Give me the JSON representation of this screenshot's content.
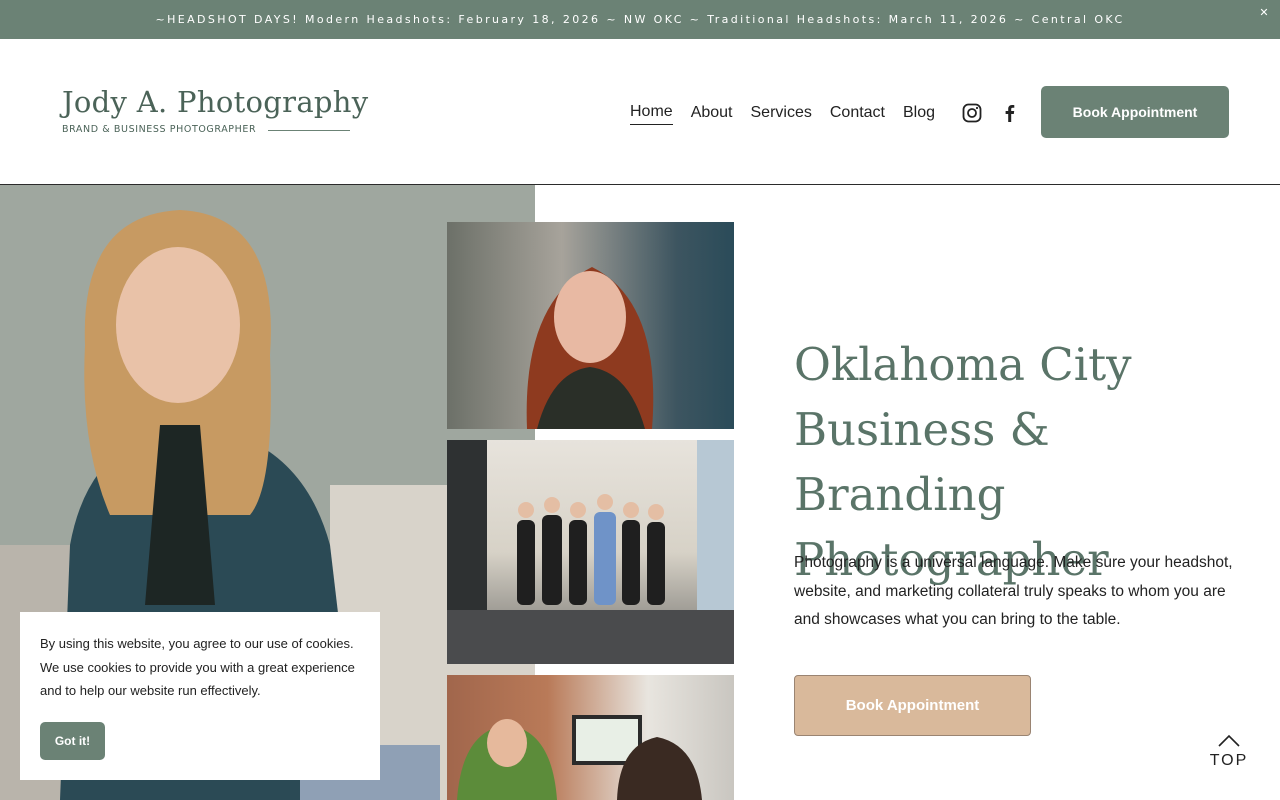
{
  "announcement": {
    "text": "~HEADSHOT DAYS!   Modern Headshots: February 18, 2026 ~ NW OKC ~  Traditional Headshots: March 11, 2026 ~ Central OKC",
    "close_icon": "close-icon"
  },
  "header": {
    "logo_name": "Jody A. Photography",
    "logo_tagline": "BRAND & BUSINESS PHOTOGRAPHER",
    "nav": [
      "Home",
      "About",
      "Services",
      "Contact",
      "Blog"
    ],
    "active_nav": "Home",
    "social_icons": [
      "instagram-icon",
      "facebook-icon"
    ],
    "cta_label": "Book Appointment"
  },
  "hero": {
    "title_lines": [
      "Oklahoma City",
      "Business & Branding",
      "Photographer"
    ],
    "body": "Photography is a universal language. Make sure your headshot,  website, and marketing collateral truly speaks to whom you are and showcases what you can bring to the table.",
    "cta_label": "Book Appointment"
  },
  "cookie": {
    "text": "By using this website, you agree to our use of cookies. We use cookies to provide you with a great experience and to help our website run effectively.",
    "button_label": "Got it!"
  },
  "back_to_top": {
    "label": "TOP",
    "icon": "chevron-up-icon"
  },
  "colors": {
    "brand_green": "#6b8275",
    "title_green": "#5a7468",
    "tan_button": "#d9b99b"
  }
}
